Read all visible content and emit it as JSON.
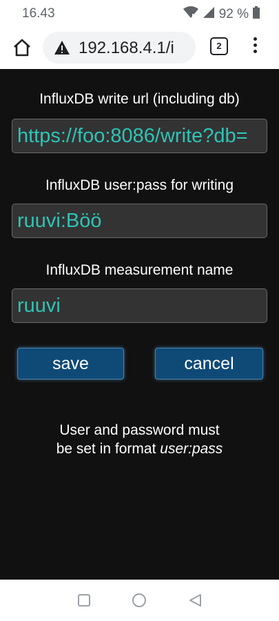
{
  "status_bar": {
    "time": "16.43",
    "battery": "92 %",
    "wifi_icon": "wifi-icon",
    "signal_icon": "signal-icon",
    "battery_icon": "battery-icon"
  },
  "browser": {
    "url": "192.168.4.1/i",
    "tab_count": "2",
    "home_icon": "home-icon",
    "warning_icon": "warning-icon",
    "menu_icon": "more-vert-icon"
  },
  "form": {
    "url_label": "InfluxDB write url (including db)",
    "url_value": "https://foo:8086/write?db=",
    "userpass_label": "InfluxDB user:pass for writing",
    "userpass_value": "ruuvi:Böö",
    "measurement_label": "InfluxDB measurement name",
    "measurement_value": "ruuvi",
    "save_label": "save",
    "cancel_label": "cancel",
    "help_line1": "User and password must",
    "help_line2_prefix": "be set in format ",
    "help_line2_em": "user:pass"
  },
  "colors": {
    "background": "#111111",
    "input_text": "#2ec4b6",
    "button": "#0f4a77"
  },
  "nav": {
    "recents_icon": "recents-icon",
    "home_icon": "home-circle-icon",
    "back_icon": "back-icon"
  }
}
